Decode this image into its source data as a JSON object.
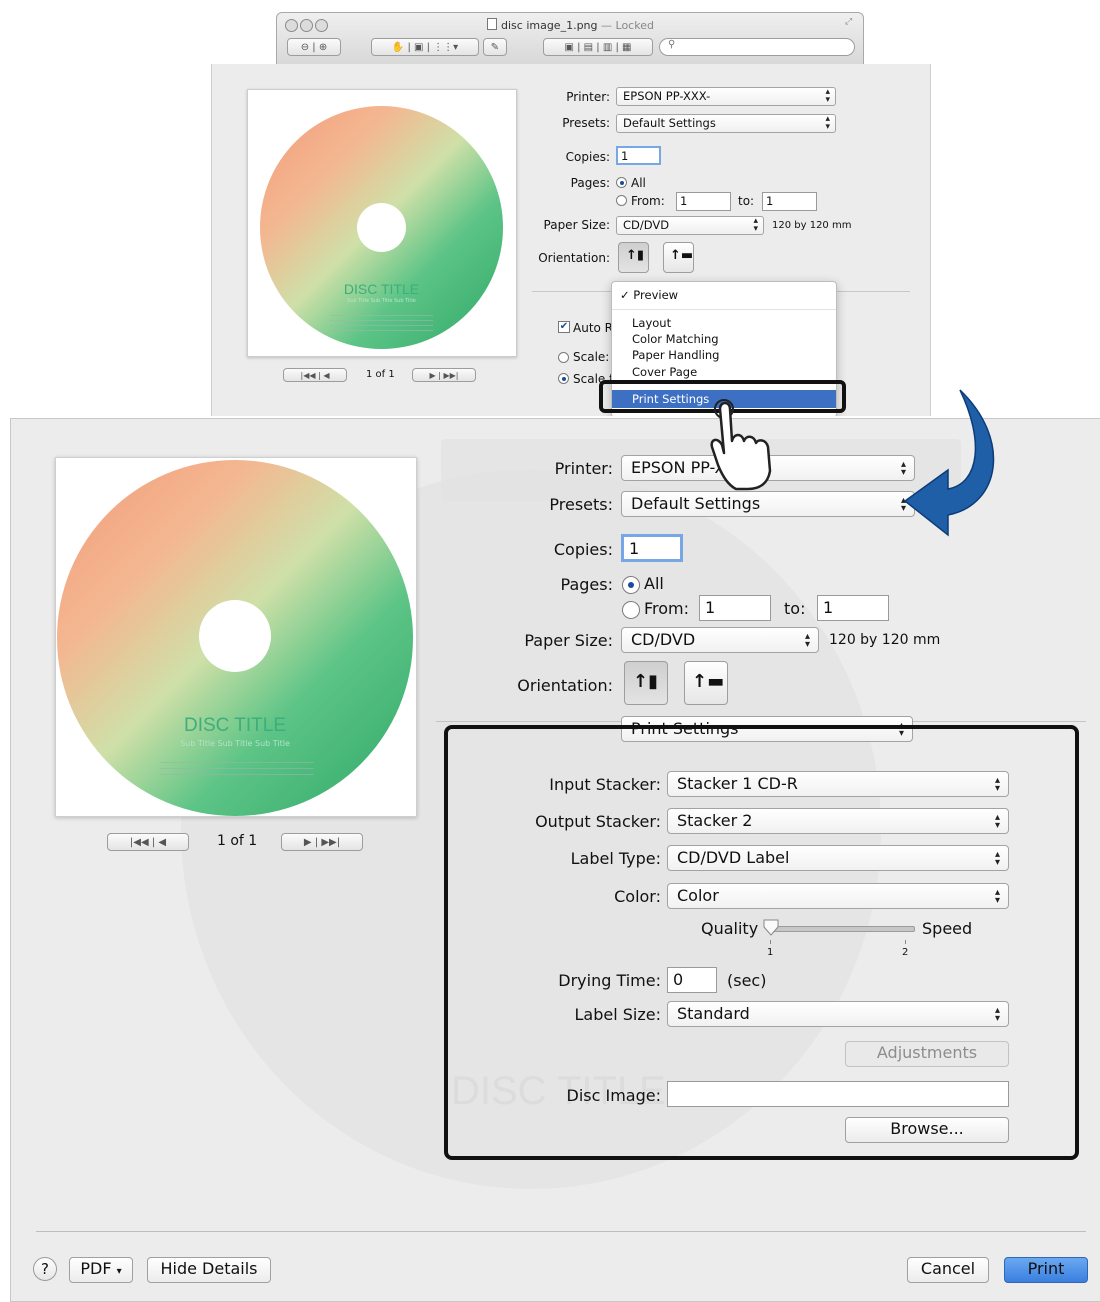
{
  "top_dialog": {
    "window_title": "disc image_1.png",
    "window_subtitle": "— Locked",
    "printer_label": "Printer:",
    "printer_value": "EPSON PP-XXX-",
    "presets_label": "Presets:",
    "presets_value": "Default Settings",
    "copies_label": "Copies:",
    "copies_value": "1",
    "pages_label": "Pages:",
    "pages_all": "All",
    "pages_from": "From:",
    "pages_from_value": "1",
    "pages_to": "to:",
    "pages_to_value": "1",
    "paper_label": "Paper Size:",
    "paper_value": "CD/DVD",
    "paper_dims": "120 by 120 mm",
    "orientation_label": "Orientation:",
    "auto_label": "Auto R",
    "scale_label": "Scale:",
    "scale_to_label": "Scale t",
    "page_counter": "1 of 1",
    "menu": {
      "checked_item": "✓ Preview",
      "items": [
        "Layout",
        "Color Matching",
        "Paper Handling",
        "Cover Page"
      ],
      "highlighted": "Print Settings"
    }
  },
  "disc_preview": {
    "title": "DISC TITLE",
    "subtitle": "Sub Title Sub Title Sub Title",
    "data_line": "Data Name Data Name Data Name Data Name Data Name"
  },
  "main_dialog": {
    "printer_label": "Printer:",
    "printer_value": "EPSON PP-XX",
    "presets_label": "Presets:",
    "presets_value": "Default Settings",
    "copies_label": "Copies:",
    "copies_value": "1",
    "pages_label": "Pages:",
    "pages_all": "All",
    "pages_from": "From:",
    "pages_from_value": "1",
    "pages_to": "to:",
    "pages_to_value": "1",
    "paper_label": "Paper Size:",
    "paper_value": "CD/DVD",
    "paper_dims": "120 by 120 mm",
    "orientation_label": "Orientation:",
    "section_popup": "Print Settings",
    "page_counter": "1 of 1",
    "input_stacker_label": "Input Stacker:",
    "input_stacker_value": "Stacker 1 CD-R",
    "output_stacker_label": "Output Stacker:",
    "output_stacker_value": "Stacker 2",
    "label_type_label": "Label Type:",
    "label_type_value": "CD/DVD Label",
    "color_label": "Color:",
    "color_value": "Color",
    "quality_label": "Quality",
    "speed_label": "Speed",
    "slider_tick_1": "1",
    "slider_tick_2": "2",
    "quality_speed_level": 0.0,
    "drying_time_label": "Drying Time:",
    "drying_time_value": "0",
    "drying_time_unit": "(sec)",
    "label_size_label": "Label Size:",
    "label_size_value": "Standard",
    "adjustments_button": "Adjustments",
    "disc_image_label": "Disc Image:",
    "disc_image_value": "",
    "browse_button": "Browse...",
    "help_button": "?",
    "pdf_button": "PDF",
    "hide_details_button": "Hide Details",
    "cancel_button": "Cancel",
    "print_button": "Print"
  },
  "colors": {
    "arrow": "#1f5fa8",
    "menu_highlight": "#3d6fc3",
    "print_button": "#3f86e0",
    "callout_border": "#111111"
  }
}
